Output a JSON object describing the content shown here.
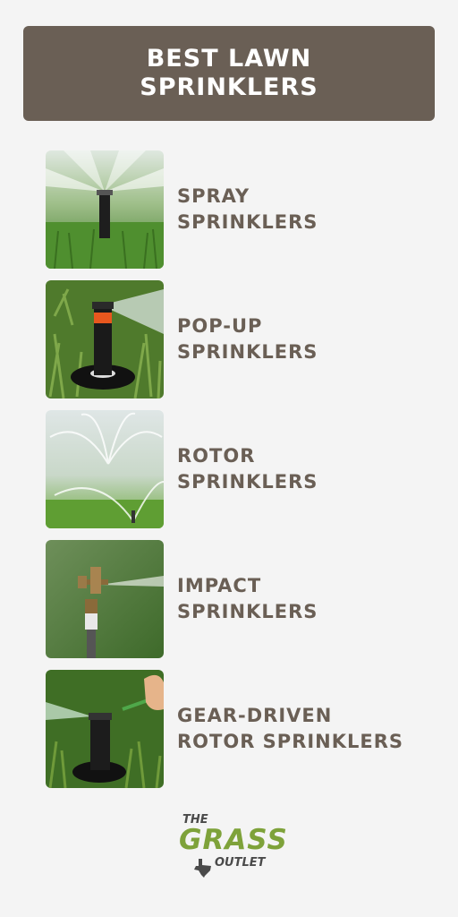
{
  "header": {
    "line1": "BEST LAWN",
    "line2": "SPRINKLERS"
  },
  "items": [
    {
      "line1": "SPRAY",
      "line2": "SPRINKLERS",
      "image": "spray-sprinkler-photo"
    },
    {
      "line1": "POP-UP",
      "line2": "SPRINKLERS",
      "image": "pop-up-sprinkler-photo"
    },
    {
      "line1": "ROTOR",
      "line2": "SPRINKLERS",
      "image": "rotor-sprinkler-photo"
    },
    {
      "line1": "IMPACT",
      "line2": "SPRINKLERS",
      "image": "impact-sprinkler-photo"
    },
    {
      "line1": "GEAR-DRIVEN",
      "line2": "ROTOR SPRINKLERS",
      "image": "gear-driven-rotor-sprinkler-photo"
    }
  ],
  "logo": {
    "the": "THE",
    "grass": "GRASS",
    "outlet": "OUTLET"
  },
  "colors": {
    "header_bg": "#6a5f55",
    "text": "#6a5f55",
    "background": "#f4f4f4",
    "logo_green": "#7ea23a"
  }
}
